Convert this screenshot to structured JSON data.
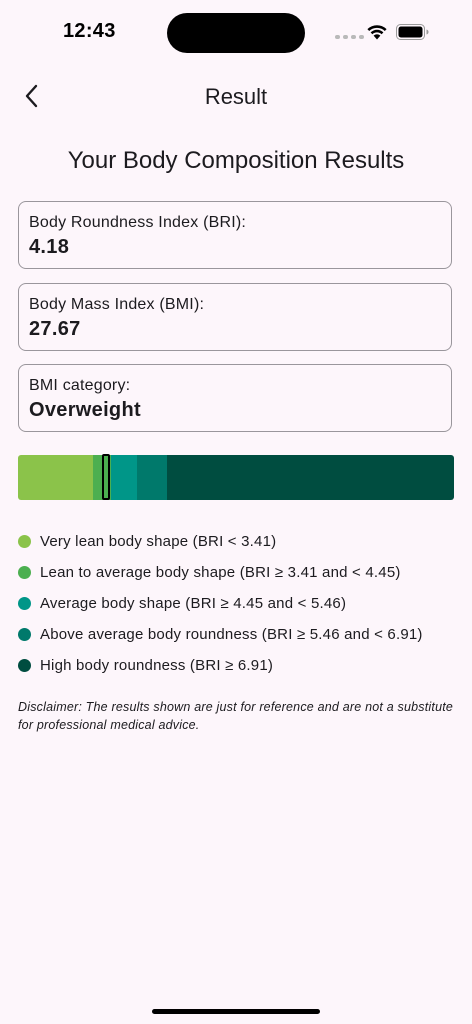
{
  "status_bar": {
    "time": "12:43"
  },
  "app_bar": {
    "title": "Result",
    "back_icon": "chevron-left-icon"
  },
  "heading": "Your Body Composition Results",
  "cards": [
    {
      "label": "Body Roundness Index (BRI):",
      "value": "4.18"
    },
    {
      "label": "Body Mass Index (BMI):",
      "value": "27.67"
    },
    {
      "label": "BMI category:",
      "value": "Overweight"
    }
  ],
  "scale": {
    "marker_bri": 4.18,
    "segments": [
      {
        "color": "#8bc34a",
        "from": 0,
        "to": 3.41
      },
      {
        "color": "#4caf50",
        "from": 3.41,
        "to": 4.45
      },
      {
        "color": "#009688",
        "from": 4.45,
        "to": 5.46
      },
      {
        "color": "#00796b",
        "from": 5.46,
        "to": 6.91
      },
      {
        "color": "#004d40",
        "from": 6.91,
        "to": 20
      }
    ]
  },
  "legend": [
    {
      "color": "#8bc34a",
      "text": "Very lean body shape (BRI < 3.41)"
    },
    {
      "color": "#4caf50",
      "text": "Lean to average body shape (BRI ≥ 3.41 and < 4.45)"
    },
    {
      "color": "#009688",
      "text": "Average body shape (BRI ≥ 4.45 and < 5.46)"
    },
    {
      "color": "#00796b",
      "text": "Above average body roundness (BRI ≥ 5.46 and < 6.91)"
    },
    {
      "color": "#004d40",
      "text": "High body roundness (BRI ≥ 6.91)"
    }
  ],
  "disclaimer": "Disclaimer: The results shown are just for reference and are not a substitute for professional medical advice."
}
